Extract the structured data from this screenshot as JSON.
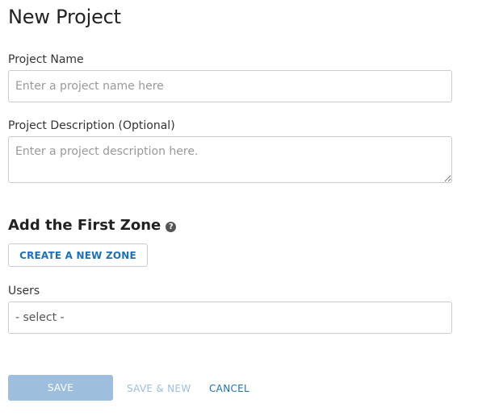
{
  "page": {
    "title": "New Project"
  },
  "form": {
    "project_name": {
      "label": "Project Name",
      "value": "",
      "placeholder": "Enter a project name here"
    },
    "project_description": {
      "label": "Project Description (Optional)",
      "value": "",
      "placeholder": "Enter a project description here."
    },
    "zone_section": {
      "title": "Add the First Zone",
      "help_icon": "question-circle-icon",
      "help_glyph": "?",
      "create_zone_label": "CREATE A NEW ZONE"
    },
    "users": {
      "label": "Users",
      "selected": "- select -"
    }
  },
  "actions": {
    "save_label": "SAVE",
    "save_new_label": "SAVE & NEW",
    "cancel_label": "CANCEL"
  },
  "colors": {
    "accent": "#1f6fb5",
    "disabled_button": "#9dbedd",
    "border": "#cccccc"
  }
}
